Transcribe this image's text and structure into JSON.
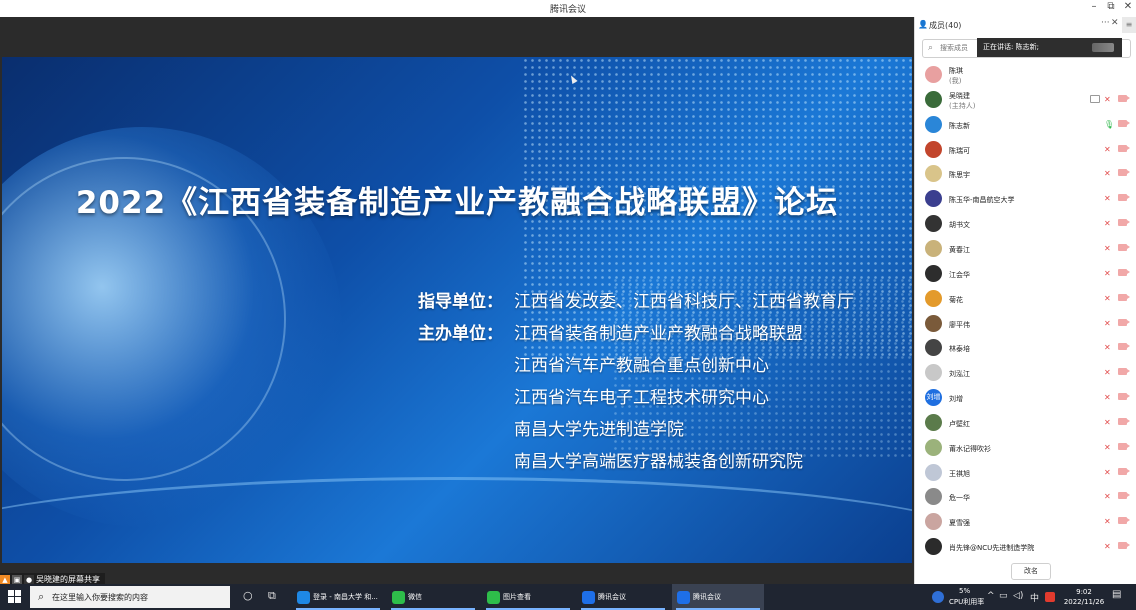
{
  "window": {
    "title": "腾讯会议",
    "controls": [
      "–",
      "⧉",
      "✕"
    ]
  },
  "slide": {
    "headline": "2022《江西省装备制造产业产教融合战略联盟》论坛",
    "guide_label": "指导单位：",
    "guide_value": "江西省发改委、江西省科技厅、江西省教育厅",
    "host_label": "主办单位：",
    "hosts": [
      "江西省装备制造产业产教融合战略联盟",
      "江西省汽车产教融合重点创新中心",
      "江西省汽车电子工程技术研究中心",
      "南昌大学先进制造学院",
      "南昌大学高端医疗器械装备创新研究院"
    ]
  },
  "share_badge": "吴晓建的屏幕共享",
  "panel": {
    "title": "成员(40)",
    "more": "···",
    "close": "✕",
    "search_placeholder": "搜索成员",
    "speaking": "正在讲话: 陈志新;",
    "members": [
      {
        "name": "陈琪",
        "role": "(我)",
        "color": "#e8a0a0",
        "mic": "none"
      },
      {
        "name": "吴晓建",
        "role": "(主持人)",
        "color": "#3a6b3a",
        "mic": "muted",
        "screen": true
      },
      {
        "name": "陈志新",
        "role": "",
        "color": "#2a86d8",
        "mic": "on"
      },
      {
        "name": "陈瑞可",
        "role": "",
        "color": "#c2452c",
        "mic": "muted"
      },
      {
        "name": "陈思宇",
        "role": "",
        "color": "#d9c48a",
        "mic": "muted"
      },
      {
        "name": "陈玉华-南昌航空大学",
        "role": "",
        "color": "#3b3f8f",
        "mic": "muted"
      },
      {
        "name": "胡书文",
        "role": "",
        "color": "#333333",
        "mic": "muted"
      },
      {
        "name": "黄春江",
        "role": "",
        "color": "#c9b27a",
        "mic": "muted"
      },
      {
        "name": "江会华",
        "role": "",
        "color": "#2d2d2d",
        "mic": "muted"
      },
      {
        "name": "菊花",
        "role": "",
        "color": "#e39a2b",
        "mic": "muted"
      },
      {
        "name": "廖平伟",
        "role": "",
        "color": "#7a5a3a",
        "mic": "muted"
      },
      {
        "name": "林泰培",
        "role": "",
        "color": "#444444",
        "mic": "muted"
      },
      {
        "name": "刘泓江",
        "role": "",
        "color": "#c8c8c8",
        "mic": "muted"
      },
      {
        "name": "刘增",
        "role": "",
        "color": "#1f6fe0",
        "mic": "muted",
        "avatar_text": "刘增"
      },
      {
        "name": "卢壁红",
        "role": "",
        "color": "#5b7b4b",
        "mic": "muted"
      },
      {
        "name": "莆水记得吹衫",
        "role": "",
        "color": "#9bb27b",
        "mic": "muted"
      },
      {
        "name": "王祺旭",
        "role": "",
        "color": "#bfc7d6",
        "mic": "muted"
      },
      {
        "name": "危一华",
        "role": "",
        "color": "#8a8a8a",
        "mic": "muted"
      },
      {
        "name": "夏雪强",
        "role": "",
        "color": "#caa5a0",
        "mic": "muted"
      },
      {
        "name": "肖先锋@NCU先进制造学院",
        "role": "",
        "color": "#2b2b2b",
        "mic": "muted"
      }
    ],
    "rename_button": "改名"
  },
  "taskbar": {
    "search_placeholder": "在这里输入你要搜索的内容",
    "tasks": [
      {
        "label": "登录 - 南昌大学 和...",
        "color": "#1e88e5",
        "active": false
      },
      {
        "label": "微信",
        "color": "#2ebd4a",
        "active": false
      },
      {
        "label": "图片查看",
        "color": "#2ebd4a",
        "active": false
      },
      {
        "label": "腾讯会议",
        "color": "#1e6fe8",
        "active": false
      },
      {
        "label": "腾讯会议",
        "color": "#1e6fe8",
        "active": true
      }
    ],
    "cpu_percent": "5%",
    "cpu_label": "CPU利用率",
    "ime": "中",
    "time": "9:02",
    "date": "2022/11/26"
  }
}
